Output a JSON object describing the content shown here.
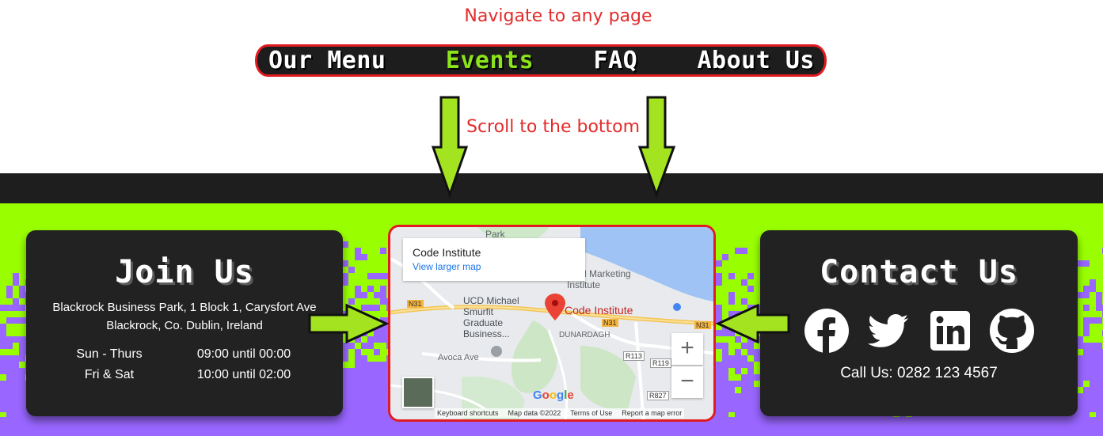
{
  "annotations": {
    "top": "Navigate to any page",
    "scroll": "Scroll to the bottom"
  },
  "nav": {
    "items": [
      {
        "label": "Our Menu",
        "active": false
      },
      {
        "label": "Events",
        "active": true
      },
      {
        "label": "FAQ",
        "active": false
      },
      {
        "label": "About Us",
        "active": false
      }
    ]
  },
  "colors": {
    "accent_green": "#99ff00",
    "nav_active": "#8be31a",
    "annotation_red": "#e32b2b",
    "card_bg": "#222222",
    "pixel_purple": "#9966ff"
  },
  "join": {
    "title": "Join Us",
    "address_line1": "Blackrock Business Park, 1 Block 1, Carysfort Ave",
    "address_line2": "Blackrock, Co. Dublin, Ireland",
    "hours": [
      {
        "days": "Sun - Thurs",
        "time": "09:00 until 00:00"
      },
      {
        "days": "Fri & Sat",
        "time": "10:00 until 02:00"
      }
    ]
  },
  "map": {
    "place_title": "Code Institute",
    "larger_map_link": "View larger map",
    "pin_label": "Code Institute",
    "labels": {
      "park": "Park",
      "digital": "igital Marketing\nInstitute",
      "ucd": "UCD Michael\nSmurfit\nGraduate\nBusiness...",
      "dunardagh": "DUNARDAGH",
      "avoca": "Avoca Ave"
    },
    "roads": [
      "N31",
      "N31",
      "N31",
      "R113",
      "R119",
      "R827"
    ],
    "zoom_in": "+",
    "zoom_out": "−",
    "google": "Google",
    "footer": [
      "Keyboard shortcuts",
      "Map data ©2022",
      "Terms of Use",
      "Report a map error"
    ]
  },
  "contact": {
    "title": "Contact Us",
    "icons": [
      "facebook-icon",
      "twitter-icon",
      "linkedin-icon",
      "github-icon"
    ],
    "phone": "Call Us: 0282 123 4567"
  }
}
